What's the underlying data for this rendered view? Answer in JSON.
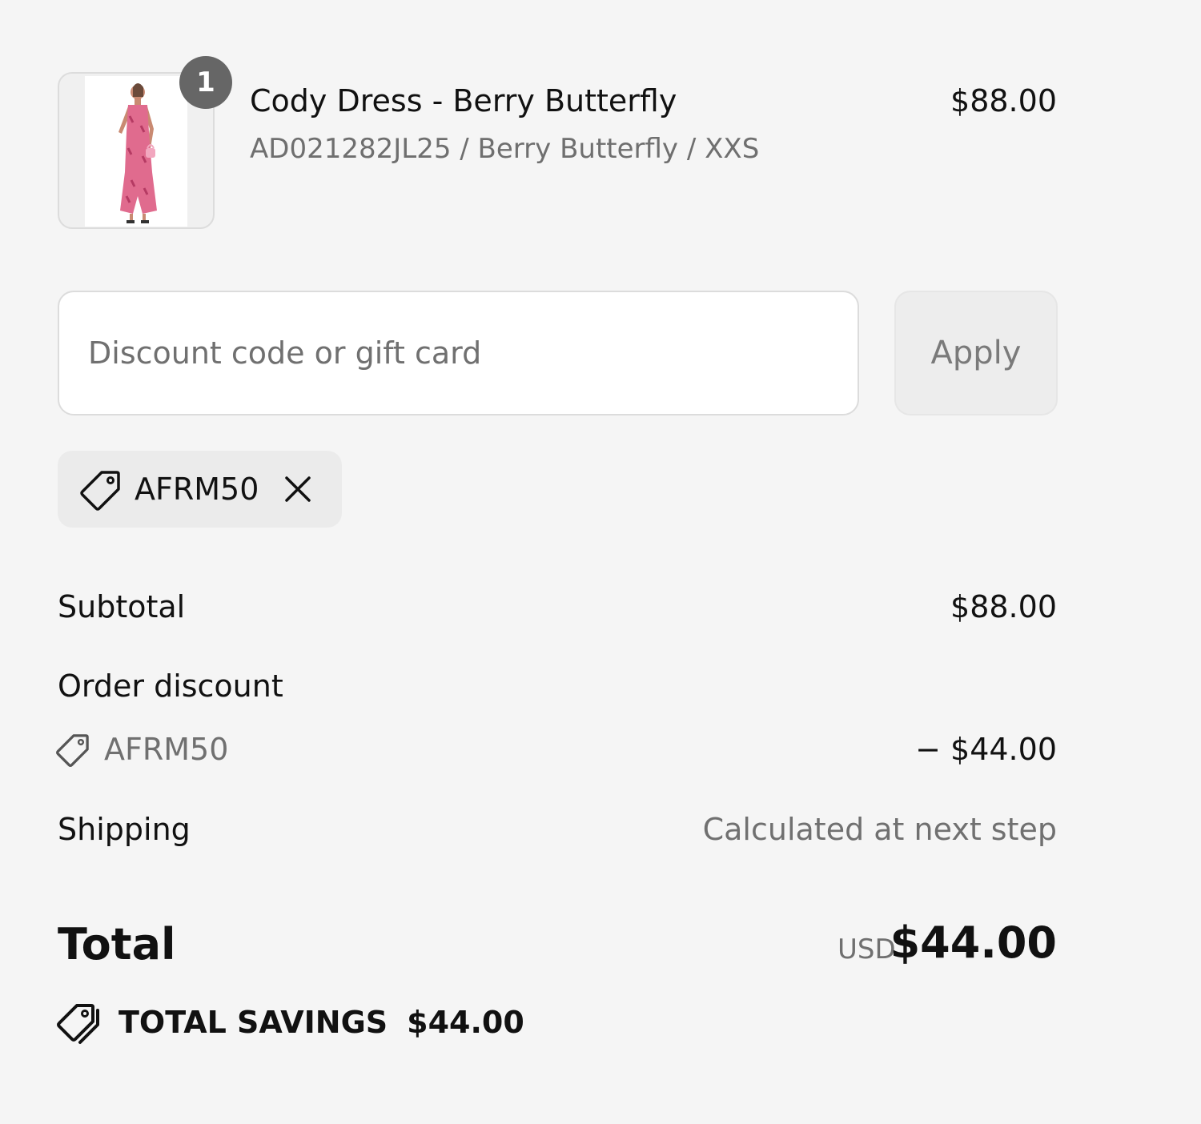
{
  "line_item": {
    "quantity": "1",
    "name": "Cody Dress - Berry Butterfly",
    "variant": "AD021282JL25 / Berry Butterfly / XXS",
    "price": "$88.00",
    "image_alt": "dress-product-image"
  },
  "discount_form": {
    "placeholder": "Discount code or gift card",
    "value": "",
    "apply_label": "Apply"
  },
  "applied_code": {
    "code": "AFRM50",
    "icon": "tag-icon",
    "remove_icon": "close-icon"
  },
  "summary": {
    "subtotal_label": "Subtotal",
    "subtotal_value": "$88.00",
    "order_discount_label": "Order discount",
    "order_discount_code": "AFRM50",
    "order_discount_value": "− $44.00",
    "shipping_label": "Shipping",
    "shipping_value": "Calculated at next step",
    "total_label": "Total",
    "total_currency": "USD",
    "total_value": "$44.00",
    "savings_label": "TOTAL SAVINGS",
    "savings_value": "$44.00"
  },
  "colors": {
    "background": "#f5f5f5",
    "badge": "#666666",
    "muted_text": "#707070",
    "chip_background": "#ebebeb",
    "apply_button_background": "#ededed"
  }
}
